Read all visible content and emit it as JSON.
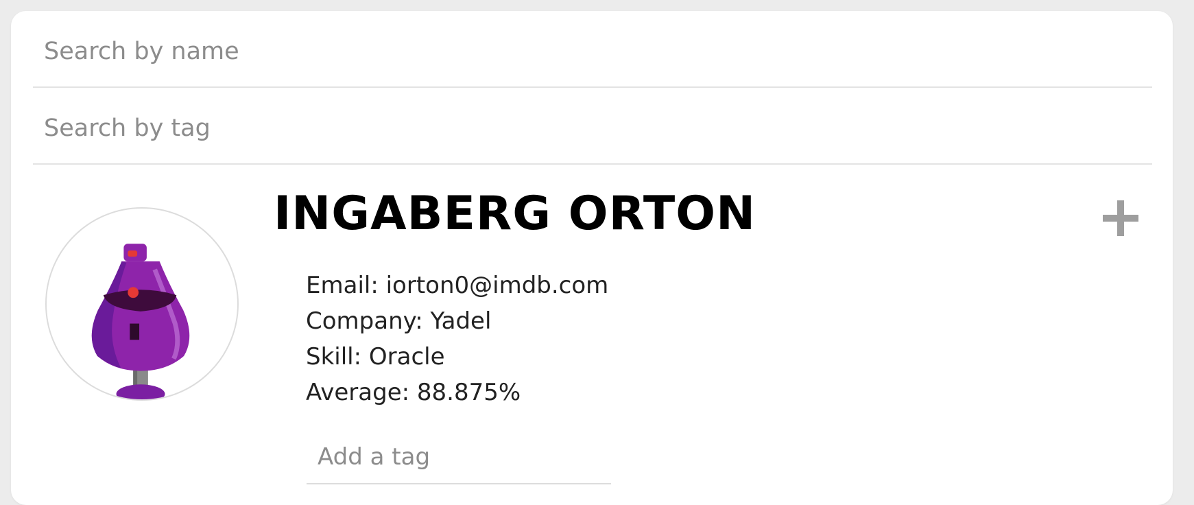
{
  "search": {
    "name_placeholder": "Search by name",
    "tag_placeholder": "Search by tag"
  },
  "student": {
    "name": "INGABERG ORTON",
    "details": [
      "Email: iorton0@imdb.com",
      "Company: Yadel",
      "Skill: Oracle",
      "Average: 88.875%"
    ],
    "tag_placeholder": "Add a tag",
    "avatar_icon": "robot-avatar-icon",
    "expand_icon": "plus-icon"
  },
  "colors": {
    "page_background": "#ececec",
    "card_background": "#ffffff",
    "placeholder_text": "#8c8c8c",
    "divider": "#e3e3e3",
    "plus_icon": "#9e9e9e",
    "avatar_robot": "#8e24aa"
  }
}
